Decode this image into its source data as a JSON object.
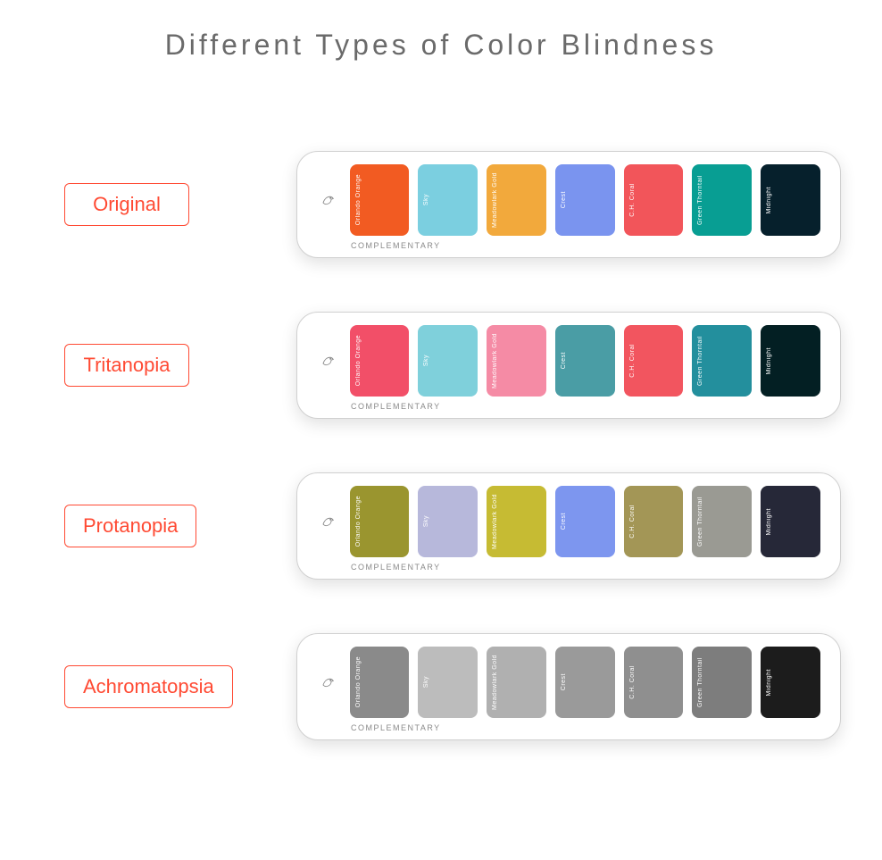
{
  "title": "Different Types of Color Blindness",
  "swatch_names": [
    "Orlando Orange",
    "Sky",
    "Meadowlark Gold",
    "Crest",
    "C.H. Coral",
    "Green Thorntail",
    "Midnight"
  ],
  "caption": "COMPLEMENTARY",
  "rows": [
    {
      "label": "Original",
      "colors": [
        "#f25b22",
        "#7bcfe0",
        "#f2a93c",
        "#7a94ef",
        "#f2555a",
        "#089e93",
        "#06202c"
      ]
    },
    {
      "label": "Tritanopia",
      "colors": [
        "#f24f68",
        "#7fd0db",
        "#f58ba5",
        "#4a9da5",
        "#f2555f",
        "#238f9d",
        "#031f23"
      ]
    },
    {
      "label": "Protanopia",
      "colors": [
        "#9a952f",
        "#b7b8db",
        "#c6bb33",
        "#7d96ef",
        "#a39656",
        "#9a9a93",
        "#262838"
      ]
    },
    {
      "label": "Achromatopsia",
      "colors": [
        "#8a8a8a",
        "#bcbcbc",
        "#b0b0b0",
        "#9a9a9a",
        "#8f8f8f",
        "#7d7d7d",
        "#1c1c1c"
      ]
    }
  ]
}
